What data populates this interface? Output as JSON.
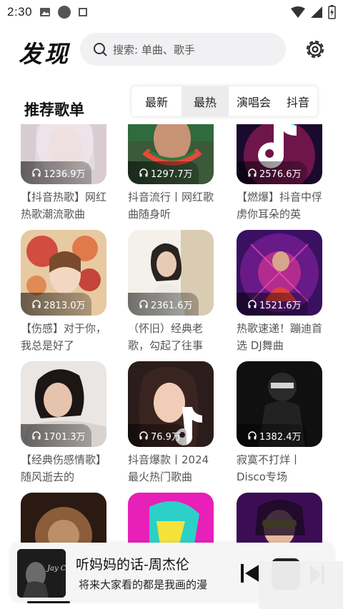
{
  "status_bar": {
    "time": "2:30"
  },
  "header": {
    "title": "发现",
    "search_placeholder": "搜索: 单曲、歌手"
  },
  "section": {
    "title": "推荐歌单",
    "tabs": [
      {
        "label": "最新",
        "active": false
      },
      {
        "label": "最热",
        "active": true
      },
      {
        "label": "演唱会",
        "active": false
      },
      {
        "label": "抖音",
        "active": false
      }
    ]
  },
  "playlists": [
    {
      "plays": "1236.9万",
      "title": "【抖音热歌】网红热歌潮流歌曲"
    },
    {
      "plays": "1297.7万",
      "title": "抖音流行丨网红歌曲随身听"
    },
    {
      "plays": "2576.6万",
      "title": "【燃爆】抖音中俘虏你耳朵的英"
    },
    {
      "plays": "2813.0万",
      "title": "【伤感】对于你，我总是好了"
    },
    {
      "plays": "2361.6万",
      "title": "（怀旧）经典老歌，勾起了往事"
    },
    {
      "plays": "1521.6万",
      "title": "热歌速递！蹦迪首选 DJ舞曲"
    },
    {
      "plays": "1701.3万",
      "title": "【经典伤感情歌】随风逝去的"
    },
    {
      "plays": "76.9万",
      "title": "抖音爆款丨2024最火热门歌曲"
    },
    {
      "plays": "1382.4万",
      "title": "寂寞不打烊丨Disco专场"
    },
    {
      "plays": "",
      "title": ""
    },
    {
      "plays": "",
      "title": ""
    },
    {
      "plays": "",
      "title": ""
    }
  ],
  "player": {
    "song": "听妈妈的话-周杰伦",
    "lyric": "将来大家看的都是我画的漫",
    "cover_text": "Jay Chou"
  },
  "colors": {
    "accent": "#111111",
    "search_bg": "#f1f1f3",
    "player_bg": "#f5f5f6"
  }
}
